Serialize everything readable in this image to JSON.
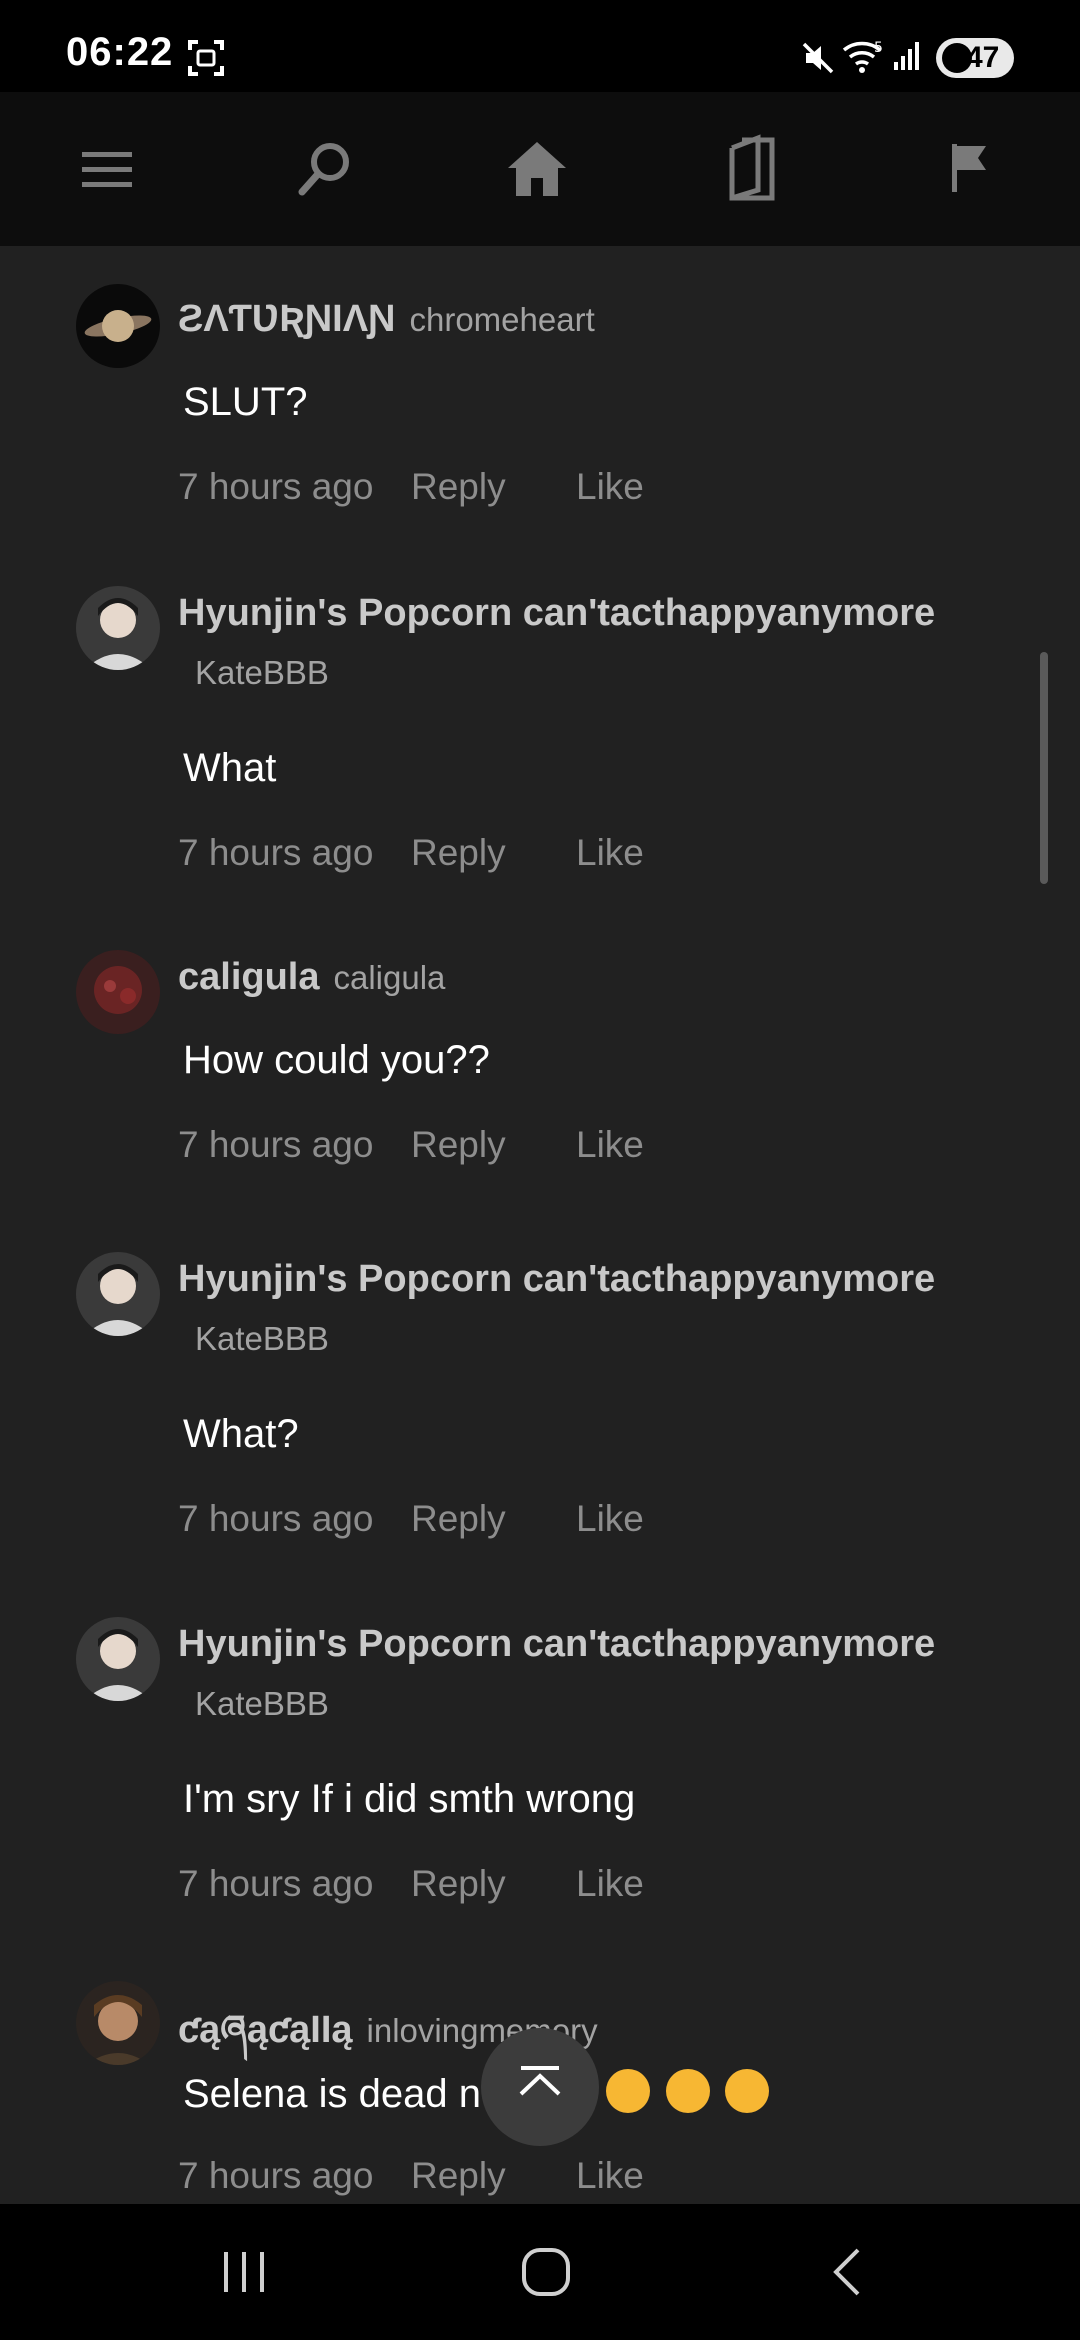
{
  "status_bar": {
    "time": "06:22",
    "battery_level": "47",
    "icons": [
      "screenshot-icon",
      "mute-icon",
      "wifi-icon",
      "signal-icon",
      "battery-icon"
    ]
  },
  "toolbar": {
    "icons": [
      "menu-icon",
      "search-icon",
      "home-icon",
      "library-icon",
      "flag-icon"
    ]
  },
  "comments": [
    {
      "display_name": "ƧɅƬƲƦƝƖɅƝ",
      "username": "chromeheart",
      "text": "SLUT?",
      "time": "7 hours ago",
      "reply_label": "Reply",
      "like_label": "Like"
    },
    {
      "display_name": "Hyunjin's Popcorn can'tacthappyanymore",
      "username": "KateBBB",
      "text": "What",
      "time": "7 hours ago",
      "reply_label": "Reply",
      "like_label": "Like"
    },
    {
      "display_name": "caligula",
      "username": "caligula",
      "text": "How could you??",
      "time": "7 hours ago",
      "reply_label": "Reply",
      "like_label": "Like"
    },
    {
      "display_name": "Hyunjin's Popcorn can'tacthappyanymore",
      "username": "KateBBB",
      "text": "What?",
      "time": "7 hours ago",
      "reply_label": "Reply",
      "like_label": "Like"
    },
    {
      "display_name": "Hyunjin's Popcorn can'tacthappyanymore",
      "username": "KateBBB",
      "text": "I'm sry If i did smth wrong",
      "time": "7 hours ago",
      "reply_label": "Reply",
      "like_label": "Like"
    },
    {
      "display_name": "ƈąཞąƈąƖƖą",
      "username": "inlovingmemory",
      "text": "Selena is dead n",
      "time": "7 hours ago",
      "reply_label": "Reply",
      "like_label": "Like"
    }
  ],
  "nav_bar": {
    "icons": [
      "recent-apps-icon",
      "home-button-icon",
      "back-icon"
    ]
  },
  "colors": {
    "background": "#212121",
    "toolbar": "#0d0d0d",
    "name": "#c9c9c9",
    "meta": "#8d8d8d"
  }
}
